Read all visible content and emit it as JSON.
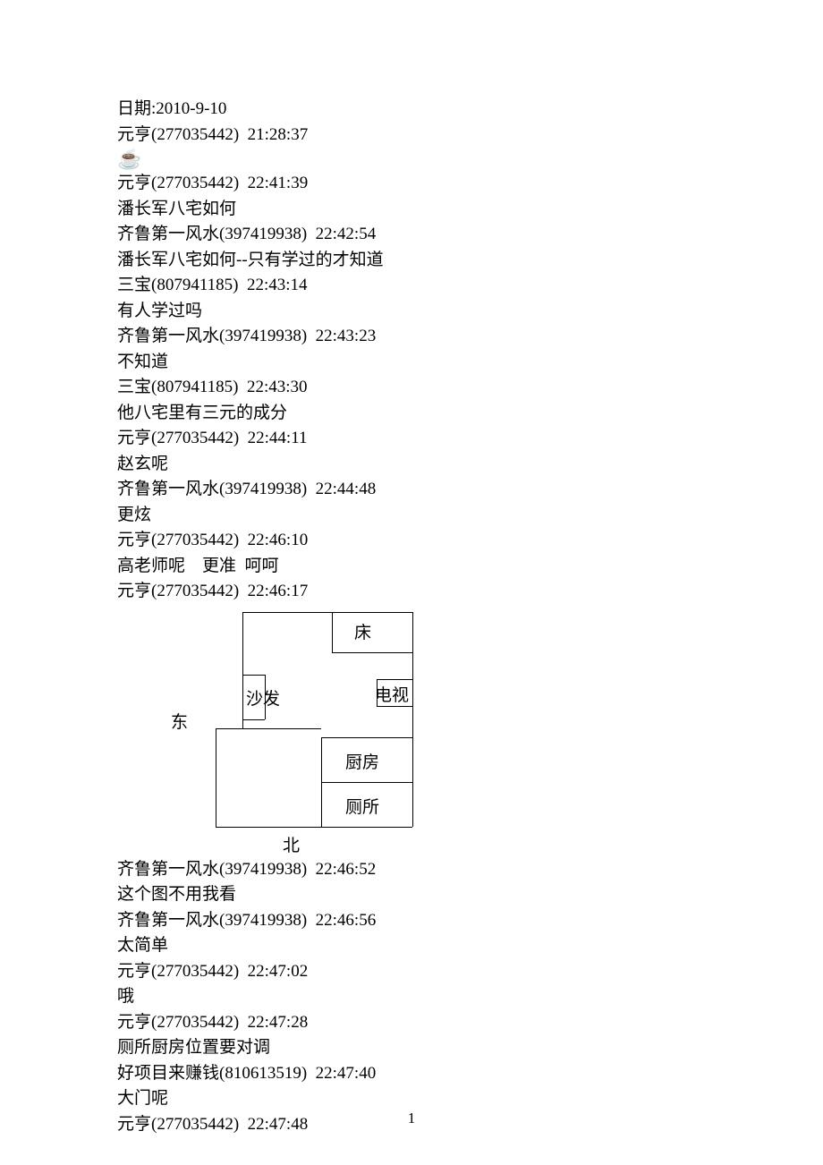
{
  "date_line": "日期:2010-9-10",
  "messages": [
    {
      "header": "元亨(277035442)  21:28:37",
      "body": []
    },
    {
      "emoji": "☕"
    },
    {
      "header": "元亨(277035442)  22:41:39",
      "body": [
        "潘长军八宅如何"
      ]
    },
    {
      "header": "齐鲁第一风水(397419938)  22:42:54",
      "body": [
        "潘长军八宅如何--只有学过的才知道"
      ]
    },
    {
      "header": "三宝(807941185)  22:43:14",
      "body": [
        "有人学过吗"
      ]
    },
    {
      "header": "齐鲁第一风水(397419938)  22:43:23",
      "body": [
        "不知道"
      ]
    },
    {
      "header": "三宝(807941185)  22:43:30",
      "body": [
        "他八宅里有三元的成分"
      ]
    },
    {
      "header": "元亨(277035442)  22:44:11",
      "body": [
        "赵玄呢"
      ]
    },
    {
      "header": "齐鲁第一风水(397419938)  22:44:48",
      "body": [
        "更炫"
      ]
    },
    {
      "header": "元亨(277035442)  22:46:10",
      "body": [
        "高老师呢    更准  呵呵"
      ]
    },
    {
      "header": "元亨(277035442)  22:46:17",
      "body": []
    }
  ],
  "diagram": {
    "east": "东",
    "north": "北",
    "bed": "床",
    "sofa": "沙发",
    "tv": "电视",
    "kitchen": "厨房",
    "toilet": "厕所"
  },
  "messages_after": [
    {
      "header": "齐鲁第一风水(397419938)  22:46:52",
      "body": [
        "这个图不用我看"
      ]
    },
    {
      "header": "齐鲁第一风水(397419938)  22:46:56",
      "body": [
        "太简单"
      ]
    },
    {
      "header": "元亨(277035442)  22:47:02",
      "body": [
        "哦"
      ]
    },
    {
      "header": "元亨(277035442)  22:47:28",
      "body": [
        "厕所厨房位置要对调"
      ]
    },
    {
      "header": "好项目来赚钱(810613519)  22:47:40",
      "body": [
        "大门呢"
      ]
    },
    {
      "header": "元亨(277035442)  22:47:48",
      "body": []
    }
  ],
  "page_number": "1"
}
